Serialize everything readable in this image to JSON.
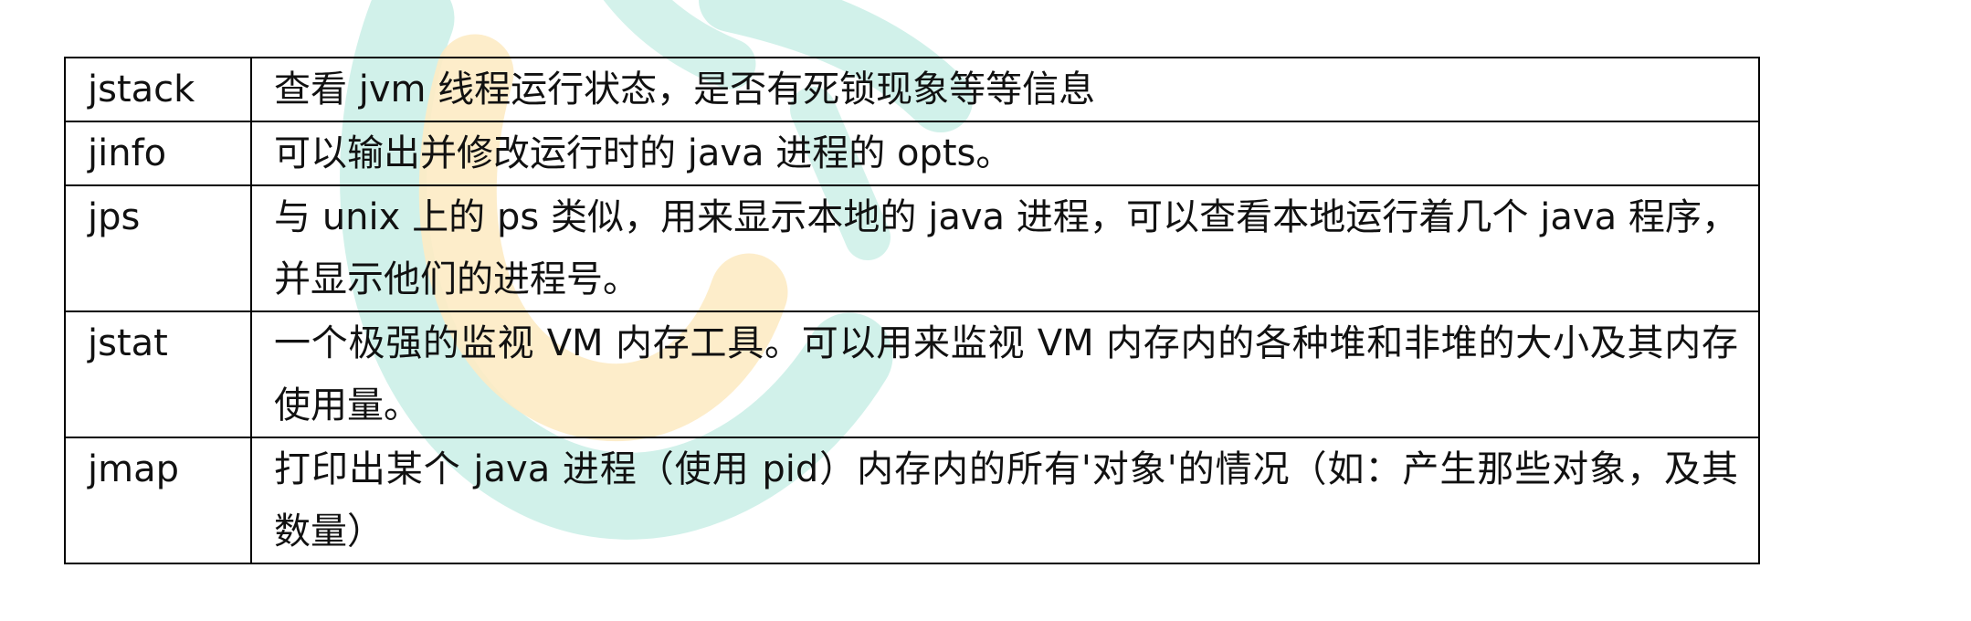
{
  "table": {
    "rows": [
      {
        "command": "jstack",
        "description": "查看 jvm 线程运行状态，是否有死锁现象等等信息"
      },
      {
        "command": "jinfo",
        "description": "可以输出并修改运行时的 java  进程的 opts。"
      },
      {
        "command": "jps",
        "description": "与 unix 上的 ps 类似，用来显示本地的 java 进程，可以查看本地运行着几个 java 程序，并显示他们的进程号。"
      },
      {
        "command": "jstat",
        "description": "一个极强的监视 VM 内存工具。可以用来监视 VM 内存内的各种堆和非堆的大小及其内存使用量。"
      },
      {
        "command": "jmap",
        "description": "打印出某个 java 进程（使用 pid）内存内的所有'对象'的情况（如：产生那些对象，及其数量）"
      }
    ]
  },
  "watermark": {
    "colors": {
      "yellow": "#fdebc4",
      "teal": "#c9efe6"
    }
  }
}
